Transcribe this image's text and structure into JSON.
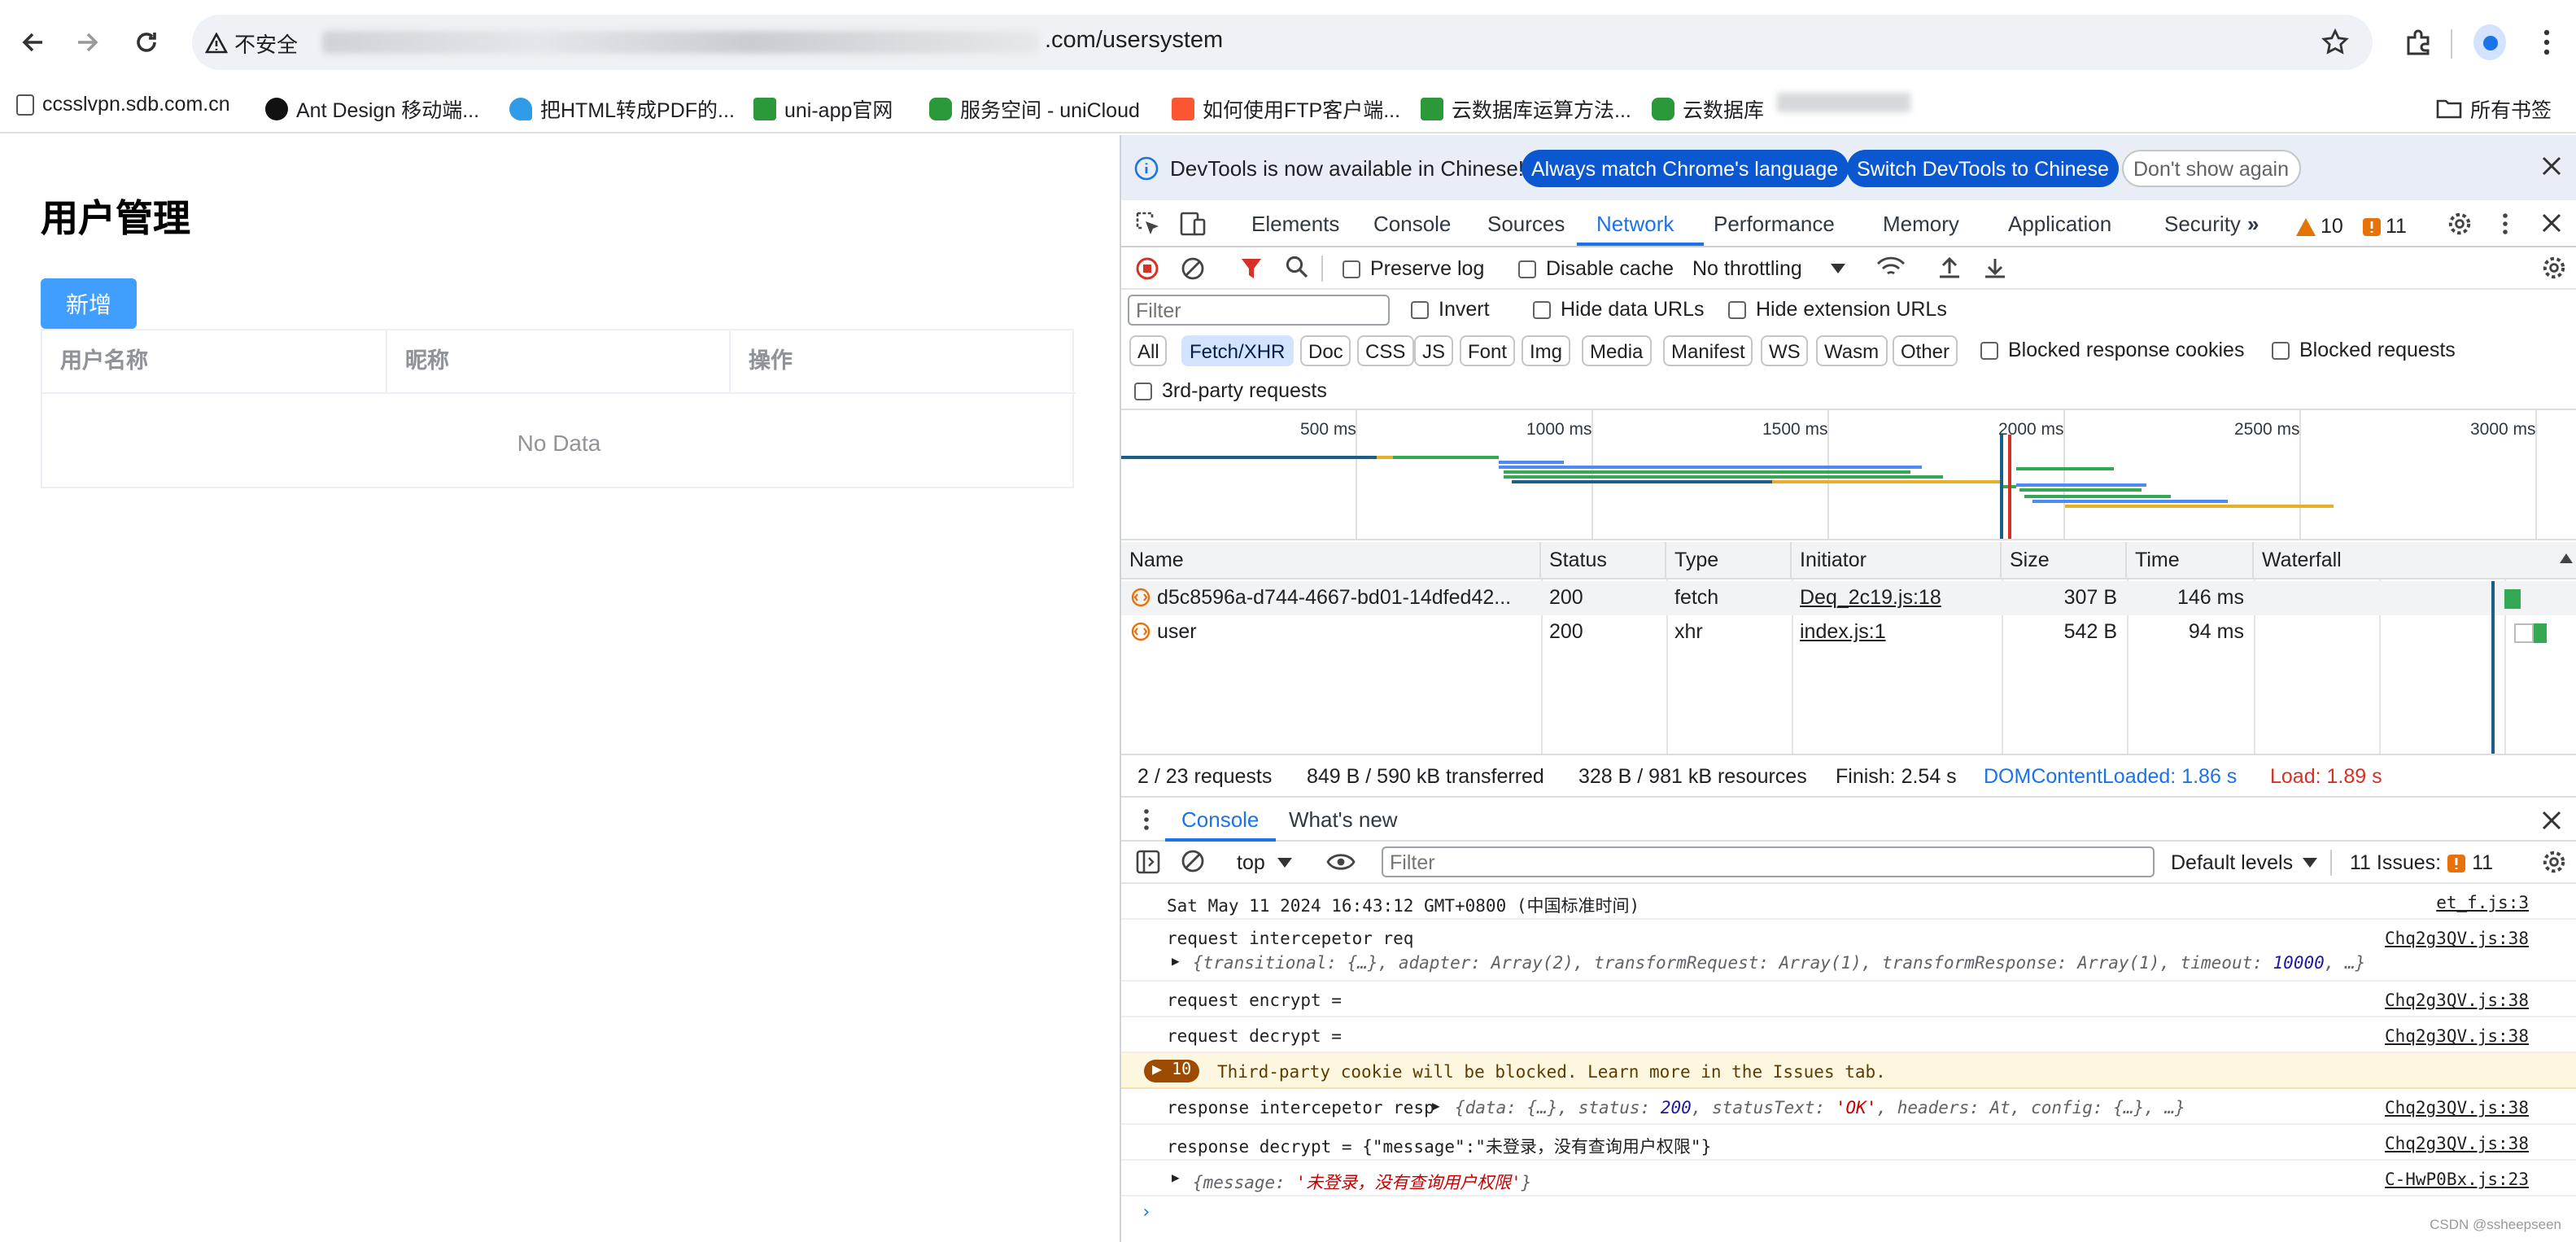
{
  "browser": {
    "security_label": "不安全",
    "url_suffix": ".com/usersystem",
    "bookmarks": [
      {
        "label": "ccsslvpn.sdb.com.cn",
        "color": "#555555"
      },
      {
        "label": "Ant Design 移动端...",
        "color": "#111111"
      },
      {
        "label": "把HTML转成PDF的...",
        "color": "#2f9be9"
      },
      {
        "label": "uni-app官网",
        "color": "#2b9939"
      },
      {
        "label": "服务空间 - uniCloud",
        "color": "#2b9939"
      },
      {
        "label": "如何使用FTP客户端...",
        "color": "#fc5531"
      },
      {
        "label": "云数据库运算方法...",
        "color": "#2b9939"
      },
      {
        "label": "云数据库",
        "color": "#2b9939"
      }
    ],
    "all_bookmarks": "所有书签"
  },
  "page": {
    "title": "用户管理",
    "add_button": "新增",
    "columns": [
      "用户名称",
      "昵称",
      "操作"
    ],
    "empty_text": "No Data"
  },
  "devtools": {
    "infobar": {
      "message": "DevTools is now available in Chinese!",
      "btn_match": "Always match Chrome's language",
      "btn_switch": "Switch DevTools to Chinese",
      "btn_dismiss": "Don't show again"
    },
    "tabs": [
      "Elements",
      "Console",
      "Sources",
      "Network",
      "Performance",
      "Memory",
      "Application",
      "Security"
    ],
    "warn_count": "10",
    "issue_count": "11",
    "network_toolbar": {
      "preserve_log": "Preserve log",
      "disable_cache": "Disable cache",
      "throttling": "No throttling"
    },
    "filter": {
      "placeholder": "Filter",
      "invert": "Invert",
      "hide_data_urls": "Hide data URLs",
      "hide_extension_urls": "Hide extension URLs",
      "types": [
        "All",
        "Fetch/XHR",
        "Doc",
        "CSS",
        "JS",
        "Font",
        "Img",
        "Media",
        "Manifest",
        "WS",
        "Wasm",
        "Other"
      ],
      "selected_type": "Fetch/XHR",
      "blocked_cookies": "Blocked response cookies",
      "blocked_requests": "Blocked requests",
      "third_party": "3rd-party requests"
    },
    "overview_ticks": [
      "500 ms",
      "1000 ms",
      "1500 ms",
      "2000 ms",
      "2500 ms",
      "3000 ms"
    ],
    "table": {
      "headers": [
        "Name",
        "Status",
        "Type",
        "Initiator",
        "Size",
        "Time",
        "Waterfall"
      ],
      "rows": [
        {
          "name": "d5c8596a-d744-4667-bd01-14dfed42...",
          "status": "200",
          "type": "fetch",
          "initiator": "Deq_2c19.js:18",
          "size": "307 B",
          "time": "146 ms"
        },
        {
          "name": "user",
          "status": "200",
          "type": "xhr",
          "initiator": "index.js:1",
          "size": "542 B",
          "time": "94 ms"
        }
      ]
    },
    "summary": {
      "requests": "2 / 23 requests",
      "transferred": "849 B / 590 kB transferred",
      "resources": "328 B / 981 kB resources",
      "finish": "Finish: 2.54 s",
      "dom_loaded": "DOMContentLoaded: 1.86 s",
      "load": "Load: 1.89 s"
    },
    "drawer_tabs": [
      "Console",
      "What's new"
    ],
    "console_toolbar": {
      "context": "top",
      "filter_placeholder": "Filter",
      "levels": "Default levels",
      "issues_label": "11 Issues:",
      "issues_count": "11"
    },
    "console_lines": {
      "l1_text": "Sat May 11 2024 16:43:12 GMT+0800 (中国标准时间)",
      "l1_src": "et_f.js:3",
      "l2_text": "request intercepetor req",
      "l2_src": "Chq2g3QV.js:38",
      "l2_sub_a": "{transitional: {…}, adapter: Array(2), transformRequest: Array(1), transformResponse: Array(1), timeout: ",
      "l2_sub_num": "10000",
      "l2_sub_b": ", …}",
      "l3_text": "request encrypt =",
      "l3_src": "Chq2g3QV.js:38",
      "l4_text": "request decrypt =",
      "l4_src": "Chq2g3QV.js:38",
      "l5_badge": "10",
      "l5_text": "Third-party cookie will be blocked. Learn more in the Issues tab.",
      "l6_text": "response intercepetor resp",
      "l6_sub_a": "{data: {…}, status: ",
      "l6_num": "200",
      "l6_sub_b": ", statusText: ",
      "l6_str": "'OK'",
      "l6_sub_c": ", headers: At, config: {…}, …}",
      "l6_src": "Chq2g3QV.js:38",
      "l7_text": "response decrypt =  {\"message\":\"未登录，没有查询用户权限\"}",
      "l7_src": "Chq2g3QV.js:38",
      "l8_a": "{message: ",
      "l8_str": "'未登录，没有查询用户权限'",
      "l8_b": "}",
      "l8_src": "C-HwP0Bx.js:23"
    },
    "watermark": "CSDN @ssheepseen"
  },
  "colors": {
    "primary": "#409eff",
    "devtools_blue": "#1a73e8",
    "load_red": "#d93025",
    "warn_bg": "#fef7e0"
  }
}
